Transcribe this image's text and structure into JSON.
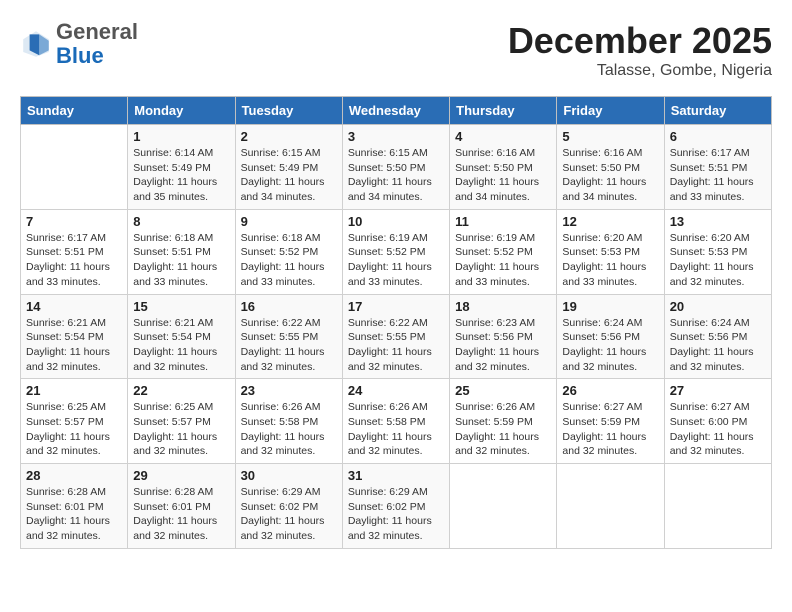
{
  "header": {
    "logo_general": "General",
    "logo_blue": "Blue",
    "month_title": "December 2025",
    "location": "Talasse, Gombe, Nigeria"
  },
  "weekdays": [
    "Sunday",
    "Monday",
    "Tuesday",
    "Wednesday",
    "Thursday",
    "Friday",
    "Saturday"
  ],
  "weeks": [
    [
      {
        "day": "",
        "sunrise": "",
        "sunset": "",
        "daylight": ""
      },
      {
        "day": "1",
        "sunrise": "Sunrise: 6:14 AM",
        "sunset": "Sunset: 5:49 PM",
        "daylight": "Daylight: 11 hours and 35 minutes."
      },
      {
        "day": "2",
        "sunrise": "Sunrise: 6:15 AM",
        "sunset": "Sunset: 5:49 PM",
        "daylight": "Daylight: 11 hours and 34 minutes."
      },
      {
        "day": "3",
        "sunrise": "Sunrise: 6:15 AM",
        "sunset": "Sunset: 5:50 PM",
        "daylight": "Daylight: 11 hours and 34 minutes."
      },
      {
        "day": "4",
        "sunrise": "Sunrise: 6:16 AM",
        "sunset": "Sunset: 5:50 PM",
        "daylight": "Daylight: 11 hours and 34 minutes."
      },
      {
        "day": "5",
        "sunrise": "Sunrise: 6:16 AM",
        "sunset": "Sunset: 5:50 PM",
        "daylight": "Daylight: 11 hours and 34 minutes."
      },
      {
        "day": "6",
        "sunrise": "Sunrise: 6:17 AM",
        "sunset": "Sunset: 5:51 PM",
        "daylight": "Daylight: 11 hours and 33 minutes."
      }
    ],
    [
      {
        "day": "7",
        "sunrise": "Sunrise: 6:17 AM",
        "sunset": "Sunset: 5:51 PM",
        "daylight": "Daylight: 11 hours and 33 minutes."
      },
      {
        "day": "8",
        "sunrise": "Sunrise: 6:18 AM",
        "sunset": "Sunset: 5:51 PM",
        "daylight": "Daylight: 11 hours and 33 minutes."
      },
      {
        "day": "9",
        "sunrise": "Sunrise: 6:18 AM",
        "sunset": "Sunset: 5:52 PM",
        "daylight": "Daylight: 11 hours and 33 minutes."
      },
      {
        "day": "10",
        "sunrise": "Sunrise: 6:19 AM",
        "sunset": "Sunset: 5:52 PM",
        "daylight": "Daylight: 11 hours and 33 minutes."
      },
      {
        "day": "11",
        "sunrise": "Sunrise: 6:19 AM",
        "sunset": "Sunset: 5:52 PM",
        "daylight": "Daylight: 11 hours and 33 minutes."
      },
      {
        "day": "12",
        "sunrise": "Sunrise: 6:20 AM",
        "sunset": "Sunset: 5:53 PM",
        "daylight": "Daylight: 11 hours and 33 minutes."
      },
      {
        "day": "13",
        "sunrise": "Sunrise: 6:20 AM",
        "sunset": "Sunset: 5:53 PM",
        "daylight": "Daylight: 11 hours and 32 minutes."
      }
    ],
    [
      {
        "day": "14",
        "sunrise": "Sunrise: 6:21 AM",
        "sunset": "Sunset: 5:54 PM",
        "daylight": "Daylight: 11 hours and 32 minutes."
      },
      {
        "day": "15",
        "sunrise": "Sunrise: 6:21 AM",
        "sunset": "Sunset: 5:54 PM",
        "daylight": "Daylight: 11 hours and 32 minutes."
      },
      {
        "day": "16",
        "sunrise": "Sunrise: 6:22 AM",
        "sunset": "Sunset: 5:55 PM",
        "daylight": "Daylight: 11 hours and 32 minutes."
      },
      {
        "day": "17",
        "sunrise": "Sunrise: 6:22 AM",
        "sunset": "Sunset: 5:55 PM",
        "daylight": "Daylight: 11 hours and 32 minutes."
      },
      {
        "day": "18",
        "sunrise": "Sunrise: 6:23 AM",
        "sunset": "Sunset: 5:56 PM",
        "daylight": "Daylight: 11 hours and 32 minutes."
      },
      {
        "day": "19",
        "sunrise": "Sunrise: 6:24 AM",
        "sunset": "Sunset: 5:56 PM",
        "daylight": "Daylight: 11 hours and 32 minutes."
      },
      {
        "day": "20",
        "sunrise": "Sunrise: 6:24 AM",
        "sunset": "Sunset: 5:56 PM",
        "daylight": "Daylight: 11 hours and 32 minutes."
      }
    ],
    [
      {
        "day": "21",
        "sunrise": "Sunrise: 6:25 AM",
        "sunset": "Sunset: 5:57 PM",
        "daylight": "Daylight: 11 hours and 32 minutes."
      },
      {
        "day": "22",
        "sunrise": "Sunrise: 6:25 AM",
        "sunset": "Sunset: 5:57 PM",
        "daylight": "Daylight: 11 hours and 32 minutes."
      },
      {
        "day": "23",
        "sunrise": "Sunrise: 6:26 AM",
        "sunset": "Sunset: 5:58 PM",
        "daylight": "Daylight: 11 hours and 32 minutes."
      },
      {
        "day": "24",
        "sunrise": "Sunrise: 6:26 AM",
        "sunset": "Sunset: 5:58 PM",
        "daylight": "Daylight: 11 hours and 32 minutes."
      },
      {
        "day": "25",
        "sunrise": "Sunrise: 6:26 AM",
        "sunset": "Sunset: 5:59 PM",
        "daylight": "Daylight: 11 hours and 32 minutes."
      },
      {
        "day": "26",
        "sunrise": "Sunrise: 6:27 AM",
        "sunset": "Sunset: 5:59 PM",
        "daylight": "Daylight: 11 hours and 32 minutes."
      },
      {
        "day": "27",
        "sunrise": "Sunrise: 6:27 AM",
        "sunset": "Sunset: 6:00 PM",
        "daylight": "Daylight: 11 hours and 32 minutes."
      }
    ],
    [
      {
        "day": "28",
        "sunrise": "Sunrise: 6:28 AM",
        "sunset": "Sunset: 6:01 PM",
        "daylight": "Daylight: 11 hours and 32 minutes."
      },
      {
        "day": "29",
        "sunrise": "Sunrise: 6:28 AM",
        "sunset": "Sunset: 6:01 PM",
        "daylight": "Daylight: 11 hours and 32 minutes."
      },
      {
        "day": "30",
        "sunrise": "Sunrise: 6:29 AM",
        "sunset": "Sunset: 6:02 PM",
        "daylight": "Daylight: 11 hours and 32 minutes."
      },
      {
        "day": "31",
        "sunrise": "Sunrise: 6:29 AM",
        "sunset": "Sunset: 6:02 PM",
        "daylight": "Daylight: 11 hours and 32 minutes."
      },
      {
        "day": "",
        "sunrise": "",
        "sunset": "",
        "daylight": ""
      },
      {
        "day": "",
        "sunrise": "",
        "sunset": "",
        "daylight": ""
      },
      {
        "day": "",
        "sunrise": "",
        "sunset": "",
        "daylight": ""
      }
    ]
  ]
}
